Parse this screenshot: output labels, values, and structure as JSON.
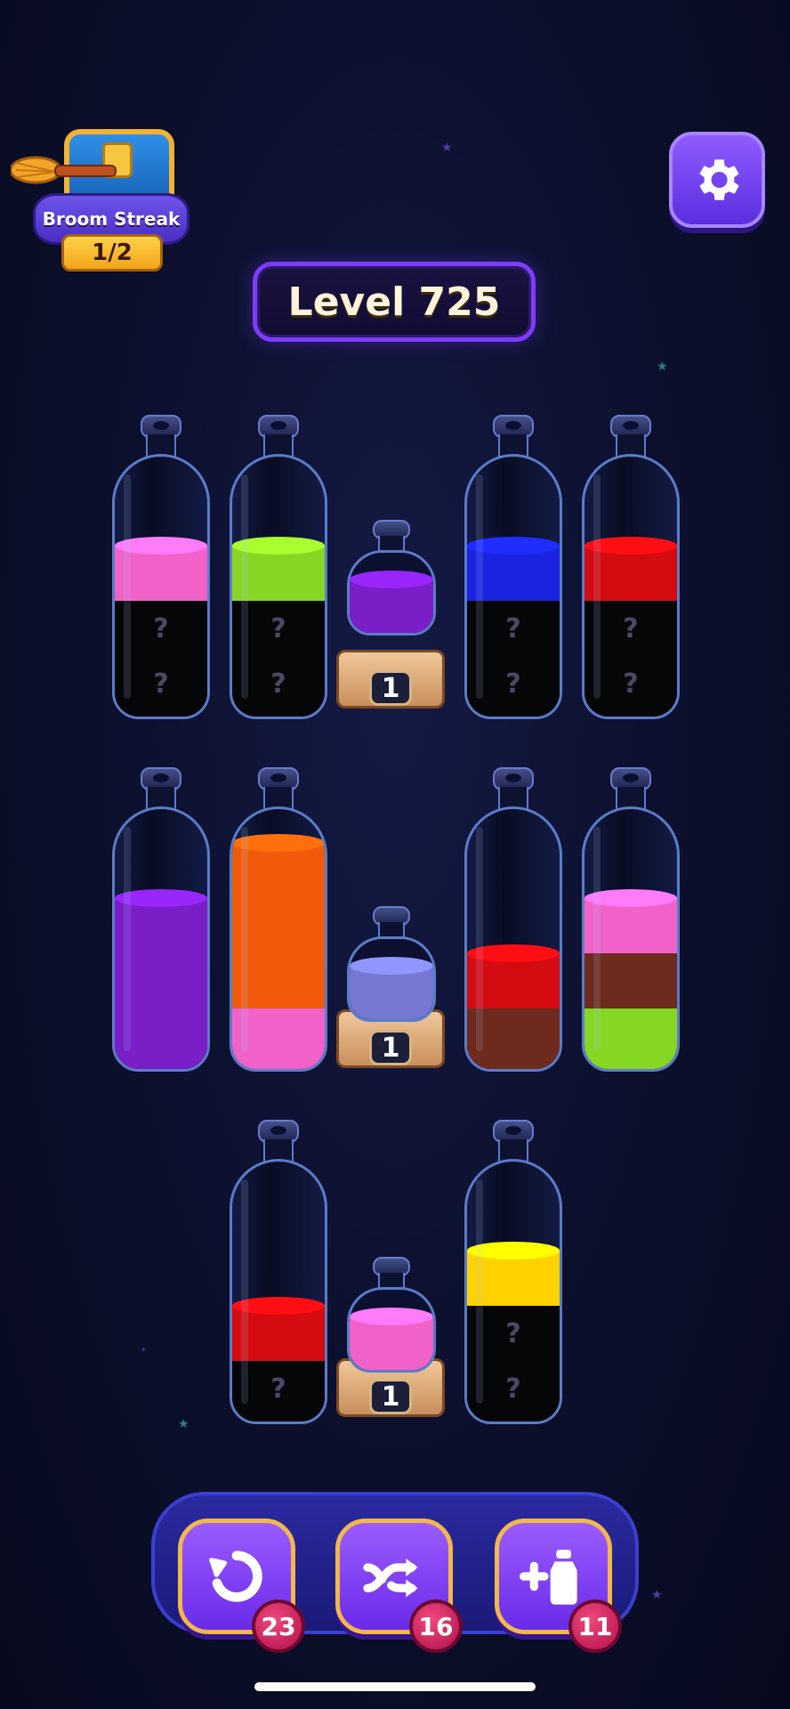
{
  "streak": {
    "title": "Broom Streak",
    "count": "1/2"
  },
  "level": {
    "label": "Level 725"
  },
  "unknown_mark": "?",
  "pedestal_numbers": [
    "1",
    "1",
    "1"
  ],
  "colors": {
    "pink": "#f062c8",
    "green": "#86d624",
    "purple": "#7a1ec8",
    "blue": "#1a24e0",
    "red": "#d40b10",
    "orange": "#f05a0a",
    "periwinkle": "#7478d0",
    "brown": "#6e2a1c",
    "yellow": "#ffd200",
    "hidden": "#050608"
  },
  "bottles": {
    "row1": [
      {
        "layers_top_to_bottom": [
          "pink",
          "?",
          "?"
        ]
      },
      {
        "layers_top_to_bottom": [
          "green",
          "?",
          "?"
        ]
      },
      {
        "jar": "purple",
        "pedestal": "1"
      },
      {
        "layers_top_to_bottom": [
          "blue",
          "?",
          "?"
        ]
      },
      {
        "layers_top_to_bottom": [
          "red",
          "?",
          "?"
        ]
      }
    ],
    "row2": [
      {
        "layers_top_to_bottom": [
          "purple",
          "purple",
          "purple"
        ]
      },
      {
        "layers_top_to_bottom": [
          "orange",
          "orange",
          "orange",
          "pink"
        ]
      },
      {
        "jar": "periwinkle",
        "pedestal": "1"
      },
      {
        "layers_top_to_bottom": [
          "red",
          "brown"
        ]
      },
      {
        "layers_top_to_bottom": [
          "pink",
          "brown",
          "green"
        ]
      }
    ],
    "row3": [
      {
        "layers_top_to_bottom": [
          "red",
          "?"
        ]
      },
      {
        "jar": "pink",
        "pedestal": "1"
      },
      {
        "layers_top_to_bottom": [
          "yellow",
          "?",
          "?"
        ]
      }
    ]
  },
  "tools": {
    "undo": {
      "icon": "undo-icon",
      "count": "23"
    },
    "shuffle": {
      "icon": "shuffle-icon",
      "count": "16"
    },
    "add_bottle": {
      "icon": "add-bottle-icon",
      "count": "11"
    }
  }
}
